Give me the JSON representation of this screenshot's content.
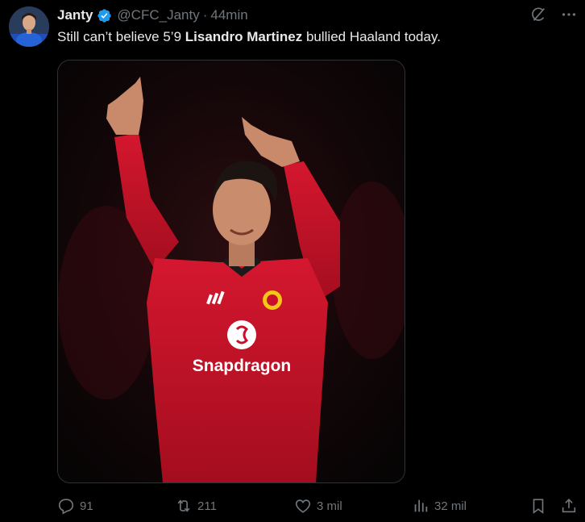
{
  "author": {
    "name": "Janty",
    "handle": "@CFC_Janty",
    "separator": "·",
    "time": "44min",
    "avatar_icon": "avatar-photo"
  },
  "tweet": {
    "text_before": "Still can’t believe 5’9 ",
    "text_bold": "Lisandro Martinez",
    "text_after": " bullied Haaland today."
  },
  "media": {
    "sponsor_text": "Snapdragon",
    "description_icon": "player-photo"
  },
  "actions": {
    "reply_count": "91",
    "retweet_count": "211",
    "like_count": "3 mil",
    "views_count": "32 mil"
  },
  "icons": {
    "verified": "verified-badge-icon",
    "grok": "grok-icon",
    "more": "more-icon",
    "reply": "reply-icon",
    "retweet": "retweet-icon",
    "like": "heart-icon",
    "views": "views-icon",
    "bookmark": "bookmark-icon",
    "share": "share-icon"
  },
  "colors": {
    "background": "#000000",
    "text_primary": "#e7e9ea",
    "text_secondary": "#71767b",
    "verified_blue": "#1d9bf0",
    "jersey_red": "#c8102e"
  }
}
